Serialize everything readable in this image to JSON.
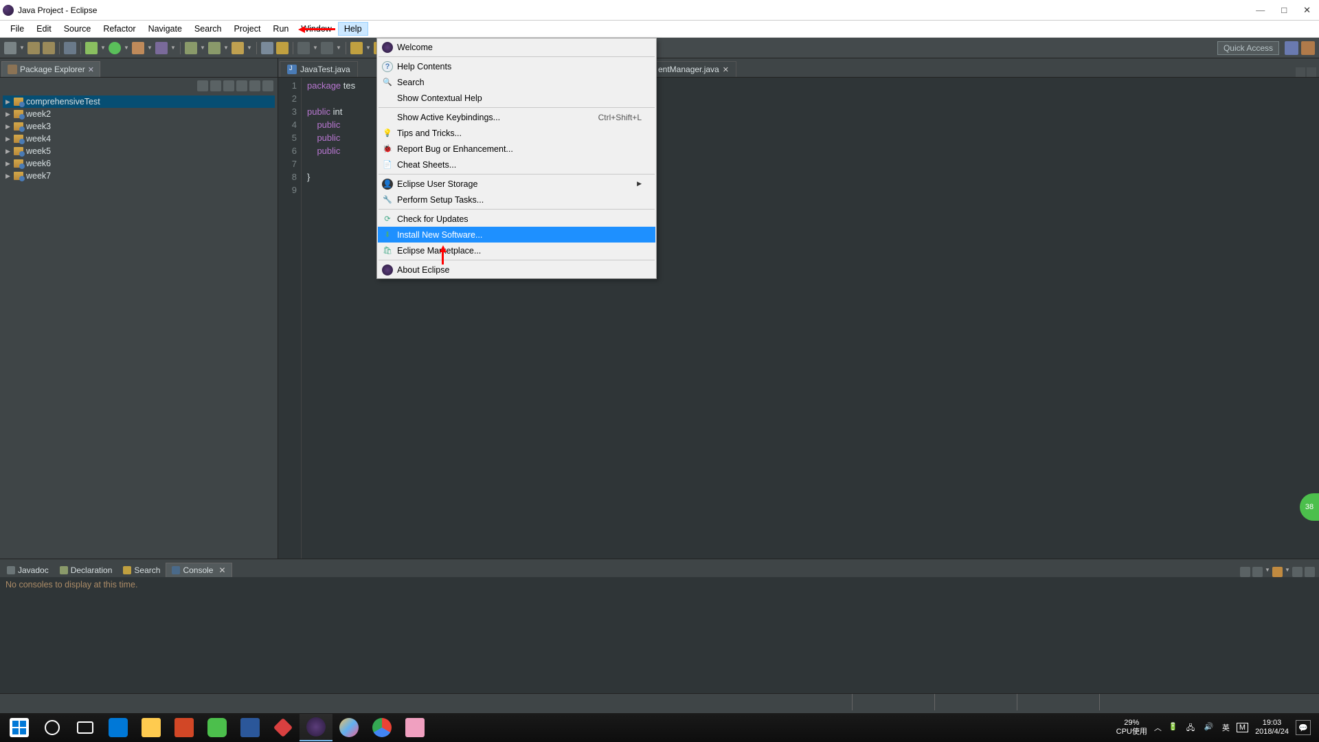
{
  "titlebar": {
    "title": "Java Project - Eclipse"
  },
  "menubar": {
    "items": [
      "File",
      "Edit",
      "Source",
      "Refactor",
      "Navigate",
      "Search",
      "Project",
      "Run",
      "Window",
      "Help"
    ]
  },
  "quick_access": "Quick Access",
  "pkg_explorer": {
    "title": "Package Explorer",
    "items": [
      "comprehensiveTest",
      "week2",
      "week3",
      "week4",
      "week5",
      "week6",
      "week7"
    ]
  },
  "editor": {
    "tabs": [
      "JavaTest.java",
      "entManager.java"
    ],
    "gutter": [
      "1",
      "2",
      "3",
      "4",
      "5",
      "6",
      "7",
      "8",
      "9"
    ],
    "code_lines": {
      "l1_kw": "package",
      "l1_rest": " tes",
      "l3_kw": "public",
      "l3_rest": " int",
      "l4_kw": "public",
      "l5_kw": "public",
      "l6_kw": "public",
      "l8": "}"
    }
  },
  "help_menu": {
    "welcome": "Welcome",
    "help_contents": "Help Contents",
    "search": "Search",
    "contextual": "Show Contextual Help",
    "keybindings": "Show Active Keybindings...",
    "keybindings_kb": "Ctrl+Shift+L",
    "tips": "Tips and Tricks...",
    "report_bug": "Report Bug or Enhancement...",
    "cheat": "Cheat Sheets...",
    "user_storage": "Eclipse User Storage",
    "setup": "Perform Setup Tasks...",
    "updates": "Check for Updates",
    "install": "Install New Software...",
    "marketplace": "Eclipse Marketplace...",
    "about": "About Eclipse"
  },
  "console": {
    "tabs": [
      "Javadoc",
      "Declaration",
      "Search",
      "Console"
    ],
    "message": "No consoles to display at this time."
  },
  "systray": {
    "cpu_pct": "29%",
    "cpu_label": "CPU使用",
    "ime1": "英",
    "ime2": "M",
    "time": "19:03",
    "date": "2018/4/24"
  },
  "float_badge": "38"
}
